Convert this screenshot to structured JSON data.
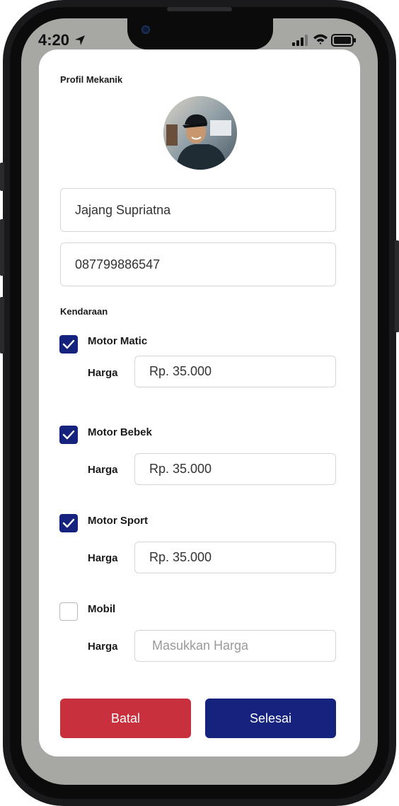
{
  "status_bar": {
    "time": "4:20"
  },
  "profile": {
    "title": "Profil Mekanik",
    "name_value": "Jajang Supriatna",
    "phone_value": "087799886547"
  },
  "vehicles": {
    "section_label": "Kendaraan",
    "price_label": "Harga",
    "items": [
      {
        "label": "Motor Matic",
        "checked": true,
        "price": "Rp. 35.000"
      },
      {
        "label": "Motor Bebek",
        "checked": true,
        "price": "Rp. 35.000"
      },
      {
        "label": "Motor Sport",
        "checked": true,
        "price": "Rp. 35.000"
      },
      {
        "label": "Mobil",
        "checked": false,
        "price_placeholder": "Masukkan Harga"
      }
    ]
  },
  "actions": {
    "cancel_label": "Batal",
    "done_label": "Selesai"
  },
  "colors": {
    "primary": "#15237f",
    "danger": "#c7303c",
    "backdrop": "#a7a7a3"
  }
}
